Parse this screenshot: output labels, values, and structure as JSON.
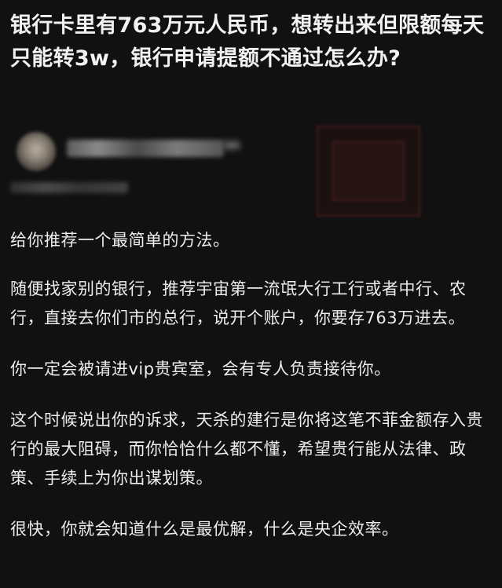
{
  "question": {
    "title": "银行卡里有763万元人民币，想转出来但限额每天只能转3w，银行申请提额不通过怎么办?"
  },
  "author": {
    "name": "██████████",
    "bio": "███████"
  },
  "answer": {
    "paragraphs": [
      "给你推荐一个最简单的方法。",
      "随便找家别的银行，推荐宇宙第一流氓大行工行或者中行、农行，直接去你们市的总行，说开个账户，你要存763万进去。",
      "你一定会被请进vip贵宾室，会有专人负责接待你。",
      "这个时候说出你的诉求，天杀的建行是你将这笔不菲金额存入贵行的最大阻碍，而你恰恰什么都不懂，希望贵行能从法律、政策、手续上为你出谋划策。",
      "很快，你就会知道什么是最优解，什么是央企效率。"
    ]
  }
}
